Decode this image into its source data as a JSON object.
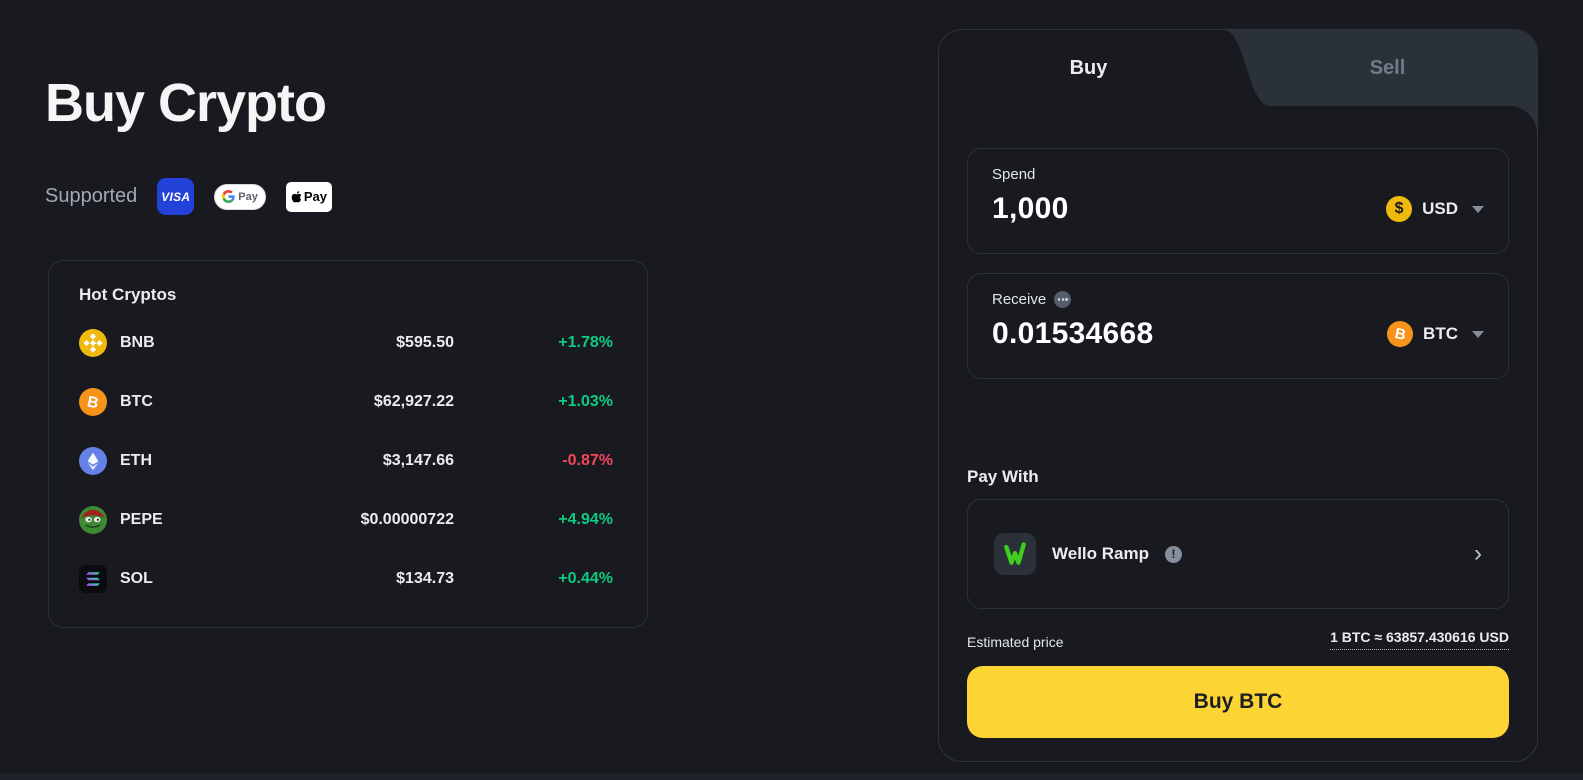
{
  "page": {
    "title": "Buy Crypto",
    "supported_label": "Supported",
    "payment_badges": {
      "visa": "VISA",
      "gpay": "Pay",
      "applepay": "Pay"
    }
  },
  "hot_cryptos": {
    "title": "Hot Cryptos",
    "rows": [
      {
        "symbol": "BNB",
        "price": "$595.50",
        "change": "+1.78%",
        "direction": "up"
      },
      {
        "symbol": "BTC",
        "price": "$62,927.22",
        "change": "+1.03%",
        "direction": "up"
      },
      {
        "symbol": "ETH",
        "price": "$3,147.66",
        "change": "-0.87%",
        "direction": "down"
      },
      {
        "symbol": "PEPE",
        "price": "$0.00000722",
        "change": "+4.94%",
        "direction": "up"
      },
      {
        "symbol": "SOL",
        "price": "$134.73",
        "change": "+0.44%",
        "direction": "up"
      }
    ]
  },
  "widget": {
    "tabs": {
      "buy": "Buy",
      "sell": "Sell",
      "active": "Buy"
    },
    "spend": {
      "label": "Spend",
      "value": "1,000",
      "currency": "USD",
      "currency_symbol": "$"
    },
    "receive": {
      "label": "Receive",
      "value": "0.01534668",
      "currency": "BTC",
      "currency_symbol": "B"
    },
    "pay_with": {
      "heading": "Pay With",
      "provider": "Wello Ramp"
    },
    "estimated_price": {
      "label": "Estimated price",
      "value": "1 BTC ≈ 63857.430616 USD"
    },
    "buy_button_label": "Buy BTC"
  },
  "colors": {
    "background": "#181a20",
    "panel_border": "#2e333c",
    "inactive_tab": "#2b3139",
    "accent_yellow": "#fcd535",
    "brand_yellow": "#f0b90b",
    "btc_orange": "#f7931a",
    "green_up": "#0ecb81",
    "red_down": "#f6465d"
  }
}
